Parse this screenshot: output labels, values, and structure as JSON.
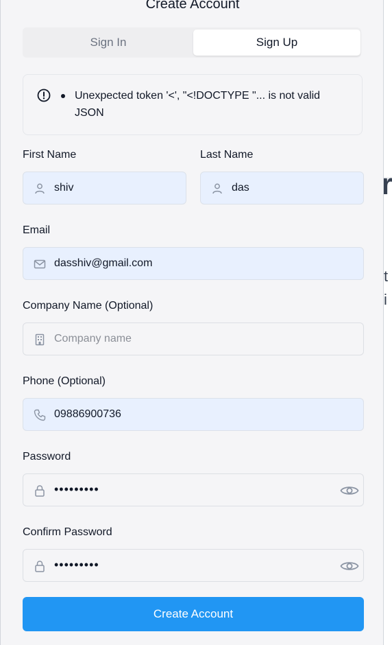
{
  "header": {
    "title": "Create Account"
  },
  "tabs": {
    "sign_in": "Sign In",
    "sign_up": "Sign Up"
  },
  "alert": {
    "message": "Unexpected token '<', \"<!DOCTYPE \"... is not valid JSON"
  },
  "form": {
    "first_name": {
      "label": "First Name",
      "value": "shiv"
    },
    "last_name": {
      "label": "Last Name",
      "value": "das"
    },
    "email": {
      "label": "Email",
      "value": "dasshiv@gmail.com"
    },
    "company": {
      "label": "Company Name (Optional)",
      "placeholder": "Company name"
    },
    "phone": {
      "label": "Phone (Optional)",
      "value": "09886900736"
    },
    "password": {
      "label": "Password",
      "masked": "•••••••••"
    },
    "confirm_password": {
      "label": "Confirm Password",
      "masked": "•••••••••"
    },
    "submit_label": "Create Account"
  },
  "colors": {
    "accent": "#2196f3",
    "autofill_bg": "#e8f0fe",
    "modal_bg": "#f5f5f7"
  },
  "icons": [
    "alert-circle-icon",
    "user-icon",
    "mail-icon",
    "building-icon",
    "phone-icon",
    "lock-icon",
    "eye-icon"
  ]
}
